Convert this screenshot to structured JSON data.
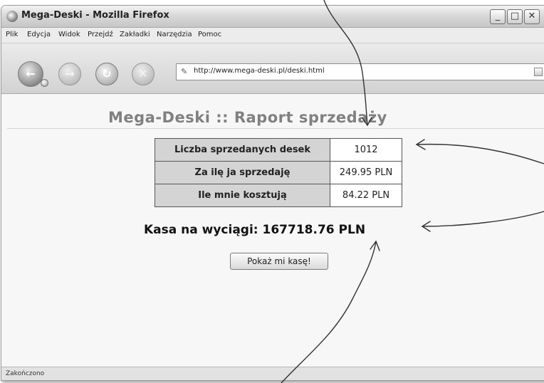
{
  "window": {
    "title": "Mega-Deski - Mozilla Firefox",
    "controls": {
      "minimize": "_",
      "maximize": "□",
      "close": "✕"
    }
  },
  "menu": {
    "items": [
      "Plik",
      "Edycja",
      "Widok",
      "Przejdź",
      "Zakładki",
      "Narzędzia",
      "Pomoc"
    ]
  },
  "toolbar": {
    "back_icon": "back-arrow-icon",
    "forward_icon": "forward-arrow-icon",
    "reload_icon": "reload-icon",
    "stop_icon": "stop-icon",
    "url": "http://www.mega-deski.pl/deski.html"
  },
  "page": {
    "title": "Mega-Deski :: Raport sprzedaży",
    "table": [
      {
        "label": "Liczba sprzedanych desek",
        "value": "1012"
      },
      {
        "label": "Za ilę ja sprzedaję",
        "value": "249.95 PLN"
      },
      {
        "label": "Ile mnie kosztują",
        "value": "84.22 PLN"
      }
    ],
    "total": "Kasa na wyciągi: 167718.76 PLN",
    "button_label": "Pokaż mi kasę!"
  },
  "status": {
    "text": "Zakończono"
  },
  "colors": {
    "title_gray": "#808080",
    "label_cell": "#d4d4d4"
  }
}
